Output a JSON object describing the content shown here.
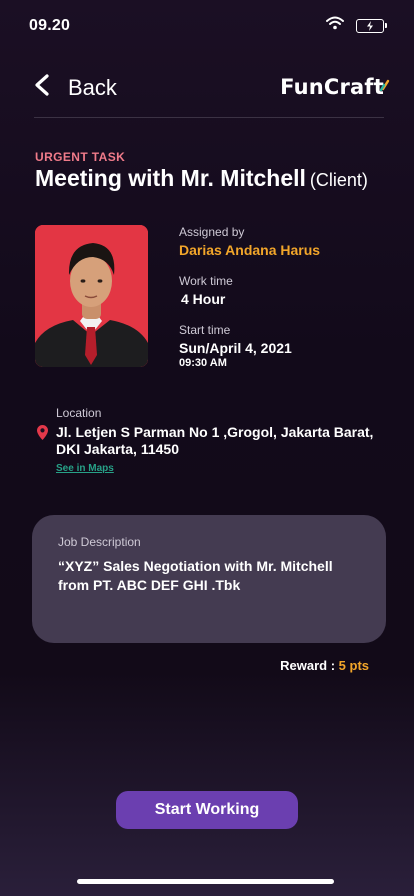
{
  "status": {
    "time": "09.20"
  },
  "nav": {
    "back_label": "Back",
    "logo": "FunCraft"
  },
  "task": {
    "urgency": "URGENT TASK",
    "title": "Meeting with Mr. Mitchell",
    "role": "(Client)"
  },
  "details": {
    "assigned_label": "Assigned by",
    "assigned_value": "Darias Andana Harus",
    "work_label": "Work time",
    "work_value": "4 Hour",
    "start_label": "Start time",
    "start_date": "Sun/April 4, 2021",
    "start_time": "09:30 AM"
  },
  "location": {
    "label": "Location",
    "address": "Jl. Letjen S Parman No 1 ,Grogol, Jakarta Barat, DKI Jakarta, 11450",
    "maps_link": "See in Maps"
  },
  "job": {
    "label": "Job Description",
    "text": "“XYZ” Sales Negotiation with Mr. Mitchell from PT. ABC DEF GHI .Tbk"
  },
  "reward": {
    "label": "Reward :",
    "value": "5 pts"
  },
  "cta": {
    "label": "Start Working"
  },
  "colors": {
    "accent": "#f2a62a",
    "urgent": "#f07b8a",
    "button": "#6b3fb0",
    "link": "#27a187",
    "card": "#443b51"
  }
}
